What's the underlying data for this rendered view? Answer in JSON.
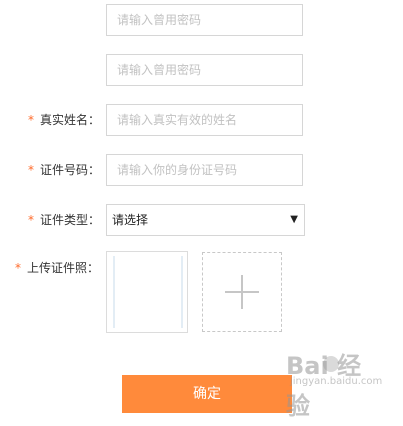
{
  "form": {
    "used_password_1": {
      "placeholder": "请输入曾用密码"
    },
    "used_password_2": {
      "placeholder": "请输入曾用密码"
    },
    "real_name": {
      "star": "*",
      "label": "真实姓名：",
      "placeholder": "请输入真实有效的姓名"
    },
    "id_number": {
      "star": "*",
      "label": "证件号码：",
      "placeholder": "请输入你的身份证号码"
    },
    "id_type": {
      "star": "*",
      "label": "证件类型：",
      "selected": "请选择",
      "arrow": "▼"
    },
    "id_photo": {
      "star": "*",
      "label": "上传证件照："
    },
    "submit_label": "确定"
  },
  "watermark": {
    "logo": "Bai  经验",
    "url": "jingyan.baidu.com"
  },
  "colors": {
    "accent": "#ff8a3b",
    "required_star": "#ff6a2a",
    "border": "#d6d6d6",
    "placeholder": "#c2c2c2"
  }
}
